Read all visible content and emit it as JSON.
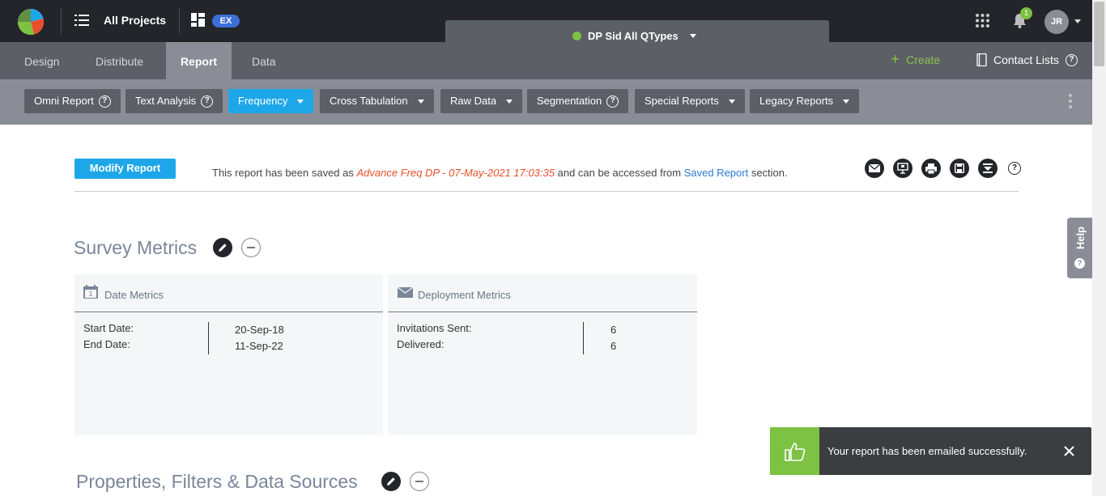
{
  "header": {
    "all_projects": "All Projects",
    "ex_badge": "EX",
    "project_name": "DP Sid All QTypes",
    "notification_count": "1",
    "avatar_initials": "JR"
  },
  "tabs": [
    "Design",
    "Distribute",
    "Report",
    "Data"
  ],
  "active_tab": "Report",
  "right_nav": {
    "create": "Create",
    "contact_lists": "Contact Lists"
  },
  "toolbar": {
    "omni": "Omni Report",
    "text_analysis": "Text Analysis",
    "frequency": "Frequency",
    "cross_tab": "Cross Tabulation",
    "raw_data": "Raw Data",
    "segmentation": "Segmentation",
    "special": "Special Reports",
    "legacy": "Legacy Reports"
  },
  "modify_label": "Modify Report",
  "saved_message": {
    "prefix": "This report has been saved as ",
    "report_name": "Advance Freq DP - 07-May-2021 17:03:35",
    "middle": " and can be accessed from ",
    "link": "Saved Report",
    "suffix": " section."
  },
  "survey_metrics": {
    "title": "Survey Metrics",
    "date_metrics": {
      "title": "Date Metrics",
      "calendar_day": "1",
      "start_label": "Start Date:",
      "end_label": "End Date:",
      "start_value": "20-Sep-18",
      "end_value": "11-Sep-22"
    },
    "deployment_metrics": {
      "title": "Deployment Metrics",
      "sent_label": "Invitations Sent:",
      "delivered_label": "Delivered:",
      "sent_value": "6",
      "delivered_value": "6"
    }
  },
  "properties_title": "Properties, Filters & Data Sources",
  "toast": {
    "message": "Your report has been emailed successfully."
  },
  "help_tab": "Help",
  "colors": {
    "accent": "#1ea7e8",
    "green": "#7dc242",
    "dark": "#23252b"
  }
}
